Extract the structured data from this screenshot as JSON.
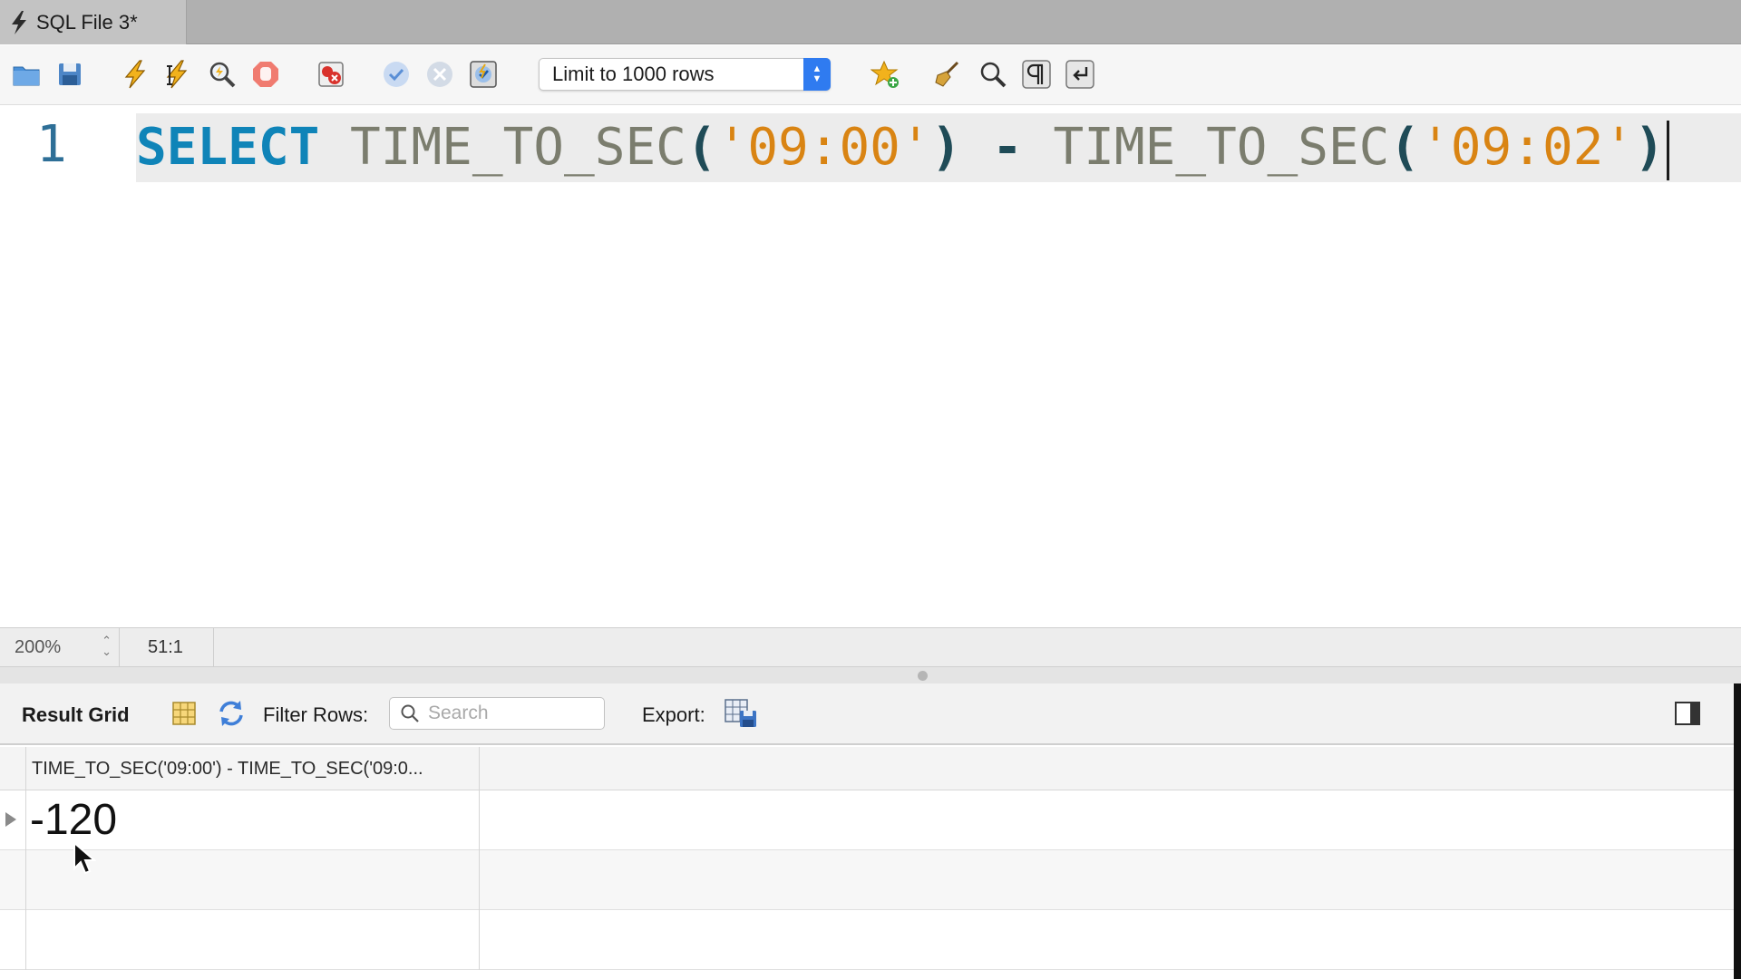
{
  "tab": {
    "title": "SQL File 3*"
  },
  "toolbar": {
    "limit_select": {
      "value": "Limit to 1000 rows"
    }
  },
  "editor": {
    "line_number": "1",
    "tokens": {
      "t1": "SELECT",
      "t2": " ",
      "t3": "TIME_TO_SEC",
      "t4": "(",
      "t5": "'09:00'",
      "t6": ")",
      "t7": " ",
      "t8": "-",
      "t9": " ",
      "t10": "TIME_TO_SEC",
      "t11": "(",
      "t12": "'09:02'",
      "t13": ")"
    }
  },
  "status": {
    "zoom": "200%",
    "cursor_position": "51:1"
  },
  "results": {
    "label": "Result Grid",
    "filter_label": "Filter Rows:",
    "search_placeholder": "Search",
    "export_label": "Export:",
    "columns": [
      "TIME_TO_SEC('09:00') - TIME_TO_SEC('09:0..."
    ],
    "rows": [
      [
        "-120"
      ]
    ]
  },
  "colors": {
    "keyword": "#0f84b8",
    "function": "#7b7d6e",
    "string": "#d98413",
    "accent": "#2f7bf0"
  }
}
